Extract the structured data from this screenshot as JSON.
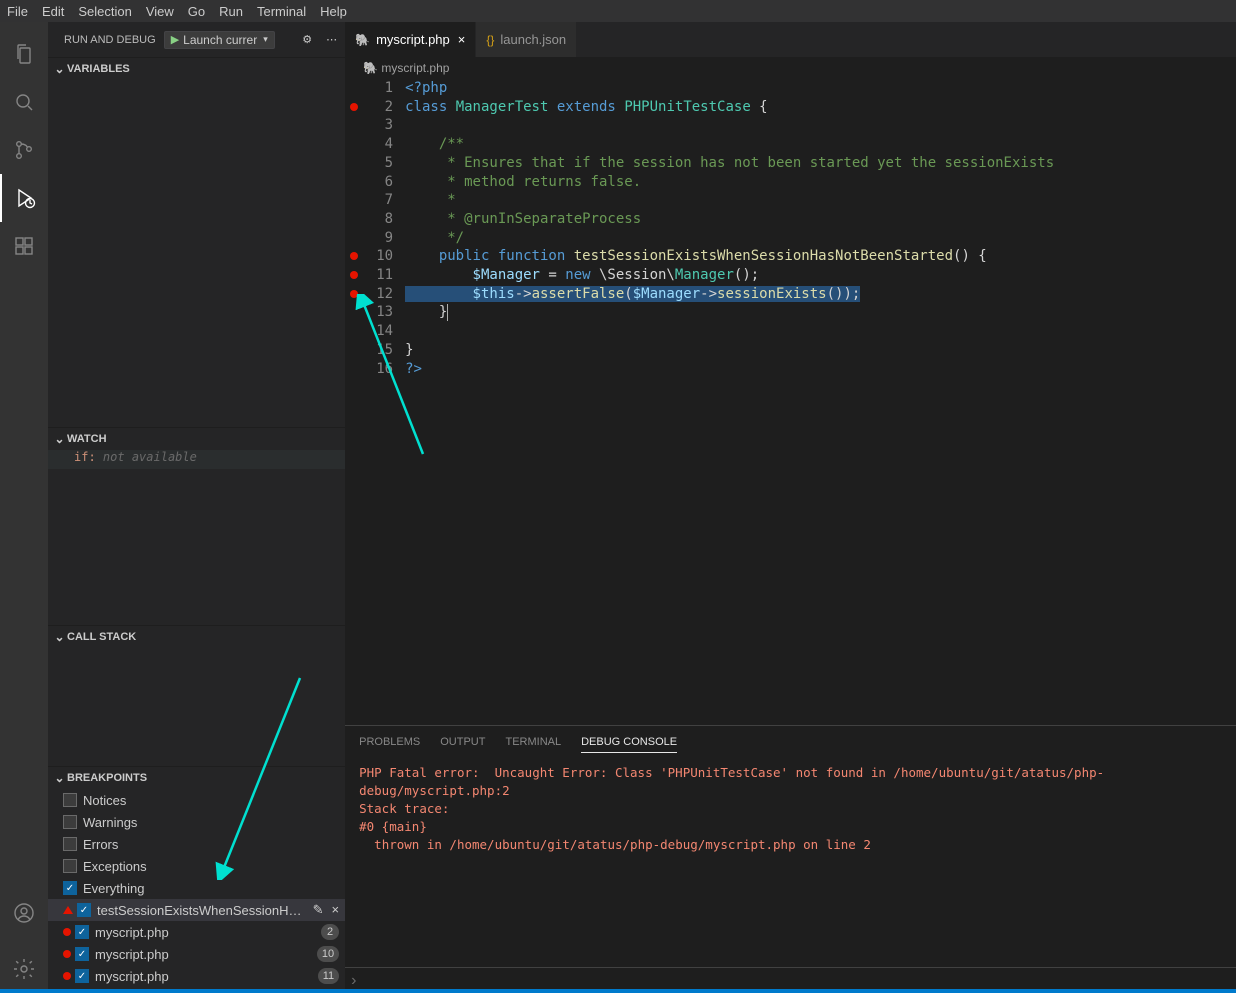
{
  "menu": [
    "File",
    "Edit",
    "Selection",
    "View",
    "Go",
    "Run",
    "Terminal",
    "Help"
  ],
  "sidebar": {
    "title": "RUN AND DEBUG",
    "launchConfig": "Launch currer",
    "sections": {
      "variables": "VARIABLES",
      "watch": "WATCH",
      "callstack": "CALL STACK",
      "breakpoints": "BREAKPOINTS"
    },
    "watchItems": [
      {
        "expr": "if:",
        "msg": "not available"
      }
    ],
    "bp_categories": [
      {
        "label": "Notices",
        "checked": false
      },
      {
        "label": "Warnings",
        "checked": false
      },
      {
        "label": "Errors",
        "checked": false
      },
      {
        "label": "Exceptions",
        "checked": false
      },
      {
        "label": "Everything",
        "checked": true
      }
    ],
    "bp_files": [
      {
        "icon": "tri",
        "label": "testSessionExistsWhenSessionH…",
        "checked": true,
        "selected": true,
        "actions": true
      },
      {
        "icon": "dot",
        "label": "myscript.php",
        "checked": true,
        "badge": "2"
      },
      {
        "icon": "dot",
        "label": "myscript.php",
        "checked": true,
        "badge": "10"
      },
      {
        "icon": "dot",
        "label": "myscript.php",
        "checked": true,
        "badge": "11"
      }
    ]
  },
  "tabs": [
    {
      "icon": "php",
      "label": "myscript.php",
      "active": true,
      "close": true
    },
    {
      "icon": "json",
      "label": "launch.json",
      "active": false,
      "close": false
    }
  ],
  "breadcrumb": "myscript.php",
  "code": {
    "breakpointLines": [
      2,
      10,
      11,
      12
    ],
    "lines": [
      {
        "n": 1,
        "html": "<span class='tok-kw'>&lt;?php</span>"
      },
      {
        "n": 2,
        "html": "<span class='tok-kw'>class</span> <span class='tok-cls'>ManagerTest</span> <span class='tok-kw'>extends</span> <span class='tok-cls'>PHPUnitTestCase</span> {"
      },
      {
        "n": 3,
        "html": ""
      },
      {
        "n": 4,
        "html": "    <span class='tok-comm'>/**</span>"
      },
      {
        "n": 5,
        "html": "    <span class='tok-comm'> * Ensures that if the session has not been started yet the sessionExists</span>"
      },
      {
        "n": 6,
        "html": "    <span class='tok-comm'> * method returns false.</span>"
      },
      {
        "n": 7,
        "html": "    <span class='tok-comm'> *</span>"
      },
      {
        "n": 8,
        "html": "    <span class='tok-comm'> * @runInSeparateProcess</span>"
      },
      {
        "n": 9,
        "html": "    <span class='tok-comm'> */</span>"
      },
      {
        "n": 10,
        "html": "    <span class='tok-kw'>public</span> <span class='tok-kw'>function</span> <span class='tok-fn'>testSessionExistsWhenSessionHasNotBeenStarted</span>() {"
      },
      {
        "n": 11,
        "html": "        <span class='tok-var'>$Manager</span> = <span class='tok-kw'>new</span> \\Session\\<span class='tok-cls'>Manager</span>();"
      },
      {
        "n": 12,
        "html": "<span class='sel-line'>        <span class='tok-var'>$this</span>-&gt;<span class='tok-fn'>assertFalse</span>(<span class='tok-var'>$Manager</span>-&gt;<span class='tok-fn'>sessionExists</span>());</span>"
      },
      {
        "n": 13,
        "html": "    }<span class='cursor-col'></span>"
      },
      {
        "n": 14,
        "html": ""
      },
      {
        "n": 15,
        "html": "}"
      },
      {
        "n": 16,
        "html": "<span class='tok-kw'>?&gt;</span>"
      }
    ]
  },
  "panelTabs": [
    "PROBLEMS",
    "OUTPUT",
    "TERMINAL",
    "DEBUG CONSOLE"
  ],
  "activePanelTab": 3,
  "consoleLines": [
    "PHP Fatal error:  Uncaught Error: Class 'PHPUnitTestCase' not found in /home/ubuntu/git/atatus/php-debug/myscript.php:2",
    "Stack trace:",
    "#0 {main}",
    "  thrown in /home/ubuntu/git/atatus/php-debug/myscript.php on line 2"
  ]
}
